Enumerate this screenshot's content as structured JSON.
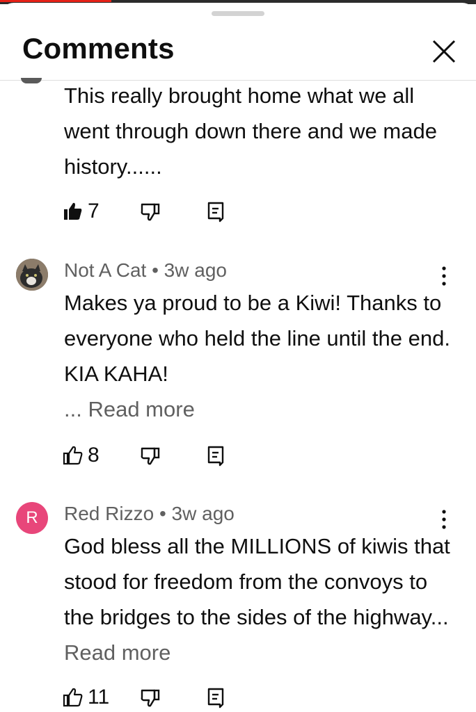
{
  "sheet": {
    "title": "Comments",
    "close_icon": "close-icon"
  },
  "comments": [
    {
      "author": "",
      "age": "",
      "text": "This really brought home what we all went through down there and we made history......",
      "read_more": "",
      "likes": "7",
      "liked": true
    },
    {
      "author": "Not A Cat",
      "age": "3w ago",
      "separator": " • ",
      "text": "Makes ya proud to be a Kiwi! Thanks to everyone who held the line until the end. KIA KAHA!",
      "ellipsis": "... ",
      "read_more": "Read more",
      "likes": "8",
      "liked": false,
      "avatar_icon": "cat-photo-avatar"
    },
    {
      "author": "Red Rizzo",
      "age": "3w ago",
      "separator": " • ",
      "text": "God bless all the MILLIONS of kiwis that stood for freedom from the convoys to the bridges to the sides of the highway...",
      "read_more": "Read more",
      "likes": "11",
      "liked": false,
      "avatar_letter": "R",
      "avatar_color": "#e8467a"
    }
  ],
  "colors": {
    "progress_red": "#e62117",
    "secondary_text": "#606060",
    "primary_text": "#0f0f0f"
  }
}
